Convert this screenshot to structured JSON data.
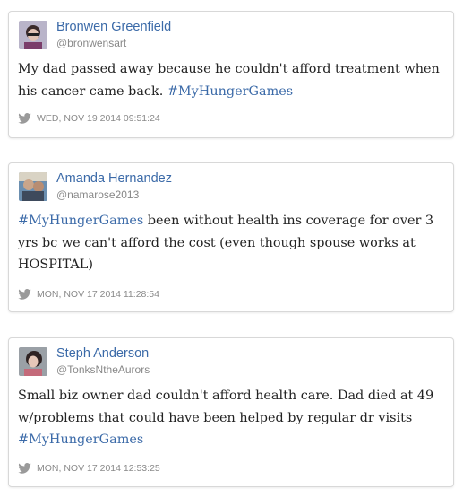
{
  "tweets": [
    {
      "name": "Bronwen Greenfield",
      "handle": "@bronwensart",
      "text_before": "My dad passed away because he couldn't afford treatment when his cancer came back. ",
      "hashtag": "#MyHungerGames",
      "text_after": "",
      "timestamp": "WED, NOV 19 2014 09:51:24",
      "icon": "twitter-bird-icon"
    },
    {
      "name": "Amanda Hernandez",
      "handle": "@namarose2013",
      "text_before": "",
      "hashtag": "#MyHungerGames",
      "text_after": " been without health ins coverage for over 3 yrs bc we can't afford the cost (even though spouse works at HOSPITAL)",
      "timestamp": "MON, NOV 17 2014 11:28:54",
      "icon": "twitter-bird-icon"
    },
    {
      "name": "Steph Anderson",
      "handle": "@TonksNtheAurors",
      "text_before": "Small biz owner dad couldn't afford health care. Dad died at 49 w/problems that could have been helped by regular dr visits ",
      "hashtag": "#MyHungerGames",
      "text_after": "",
      "timestamp": "MON, NOV 17 2014 12:53:25",
      "icon": "twitter-bird-icon"
    }
  ],
  "colors": {
    "link": "#3b6aa8",
    "meta": "#8a8a8a",
    "border": "#d8d8d8"
  }
}
